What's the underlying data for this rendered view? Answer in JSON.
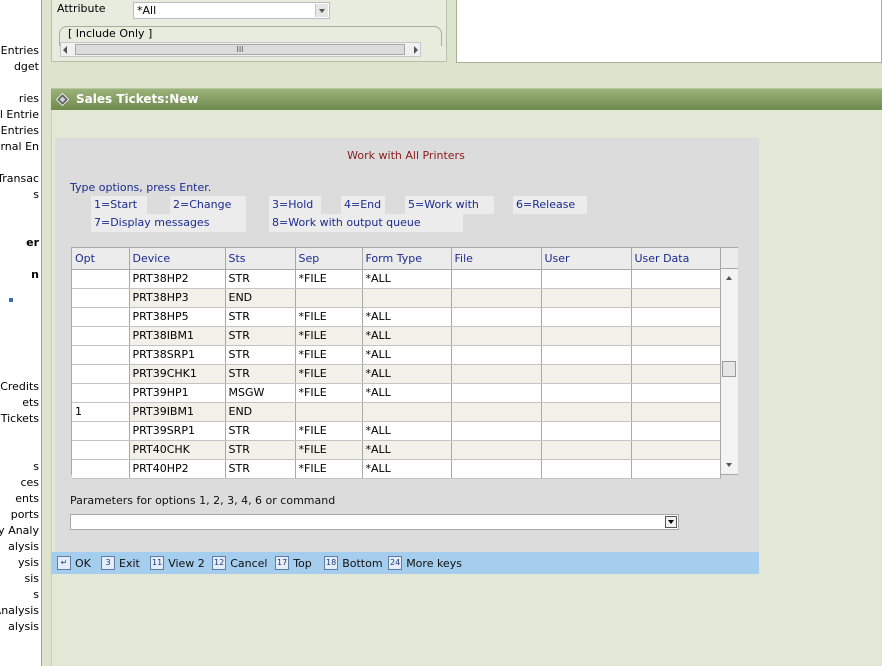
{
  "left_nav": {
    "items": [
      {
        "label": "r Entries",
        "bold": false
      },
      {
        "label": "dget",
        "bold": false
      },
      {
        "label": "ries",
        "bold": false
      },
      {
        "label": "rnal Entrie",
        "bold": false
      },
      {
        "label": "al Entries",
        "bold": false
      },
      {
        "label": "ournal En",
        "bold": false
      },
      {
        "label": "y Transac",
        "bold": false
      },
      {
        "label": "s",
        "bold": false
      },
      {
        "label": "er",
        "bold": true
      },
      {
        "label": "n",
        "bold": true
      },
      {
        "label": "Credits",
        "bold": false
      },
      {
        "label": "ets",
        "bold": false
      },
      {
        "label": "Tickets",
        "bold": false
      },
      {
        "label": "s",
        "bold": false
      },
      {
        "label": "ces",
        "bold": false
      },
      {
        "label": "ents",
        "bold": false
      },
      {
        "label": "ports",
        "bold": false
      },
      {
        "label": "ity Analy",
        "bold": false
      },
      {
        "label": "alysis",
        "bold": false
      },
      {
        "label": "ysis",
        "bold": false
      },
      {
        "label": "sis",
        "bold": false
      },
      {
        "label": "s",
        "bold": false
      },
      {
        "label": "Analysis",
        "bold": false
      },
      {
        "label": "alysis",
        "bold": false
      }
    ]
  },
  "filter": {
    "attribute_label": "Attribute",
    "attribute_value": "*All",
    "include_only_label": "[ Include Only ]",
    "scroll_thumb_grip": "III"
  },
  "header": {
    "title": "Sales Tickets:New",
    "icon": "diamond-icon",
    "accent_color": "#7b9657"
  },
  "dialog": {
    "title": "Work with All Printers",
    "instructions": "Type options, press Enter.",
    "options": [
      "1=Start",
      "2=Change",
      "3=Hold",
      "4=End",
      "5=Work with",
      "6=Release",
      "7=Display messages",
      "8=Work with output queue"
    ],
    "columns": [
      "Opt",
      "Device",
      "Sts",
      "Sep",
      "Form Type",
      "File",
      "User",
      "User Data"
    ],
    "rows": [
      {
        "opt": "",
        "device": "PRT38HP2",
        "sts": "STR",
        "sep": "*FILE",
        "form_type": "*ALL",
        "file": "",
        "user": "",
        "user_data": ""
      },
      {
        "opt": "",
        "device": "PRT38HP3",
        "sts": "END",
        "sep": "",
        "form_type": "",
        "file": "",
        "user": "",
        "user_data": ""
      },
      {
        "opt": "",
        "device": "PRT38HP5",
        "sts": "STR",
        "sep": "*FILE",
        "form_type": "*ALL",
        "file": "",
        "user": "",
        "user_data": ""
      },
      {
        "opt": "",
        "device": "PRT38IBM1",
        "sts": "STR",
        "sep": "*FILE",
        "form_type": "*ALL",
        "file": "",
        "user": "",
        "user_data": ""
      },
      {
        "opt": "",
        "device": "PRT38SRP1",
        "sts": "STR",
        "sep": "*FILE",
        "form_type": "*ALL",
        "file": "",
        "user": "",
        "user_data": ""
      },
      {
        "opt": "",
        "device": "PRT39CHK1",
        "sts": "STR",
        "sep": "*FILE",
        "form_type": "*ALL",
        "file": "",
        "user": "",
        "user_data": ""
      },
      {
        "opt": "",
        "device": "PRT39HP1",
        "sts": "MSGW",
        "sep": "*FILE",
        "form_type": "*ALL",
        "file": "",
        "user": "",
        "user_data": ""
      },
      {
        "opt": "1",
        "device": "PRT39IBM1",
        "sts": "END",
        "sep": "",
        "form_type": "",
        "file": "",
        "user": "",
        "user_data": ""
      },
      {
        "opt": "",
        "device": "PRT39SRP1",
        "sts": "STR",
        "sep": "*FILE",
        "form_type": "*ALL",
        "file": "",
        "user": "",
        "user_data": ""
      },
      {
        "opt": "",
        "device": "PRT40CHK",
        "sts": "STR",
        "sep": "*FILE",
        "form_type": "*ALL",
        "file": "",
        "user": "",
        "user_data": ""
      },
      {
        "opt": "",
        "device": "PRT40HP2",
        "sts": "STR",
        "sep": "*FILE",
        "form_type": "*ALL",
        "file": "",
        "user": "",
        "user_data": ""
      }
    ],
    "parameters_label": "Parameters for options 1, 2, 3, 4, 6 or command",
    "parameters_value": ""
  },
  "function_keys": [
    {
      "key": "↵",
      "label": "OK"
    },
    {
      "key": "3",
      "label": "Exit"
    },
    {
      "key": "11",
      "label": "View 2"
    },
    {
      "key": "12",
      "label": "Cancel"
    },
    {
      "key": "17",
      "label": "Top"
    },
    {
      "key": "18",
      "label": "Bottom"
    },
    {
      "key": "24",
      "label": "More keys"
    }
  ]
}
